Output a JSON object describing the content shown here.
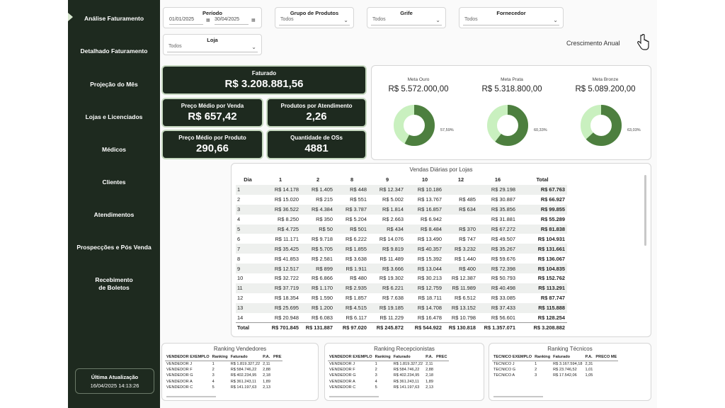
{
  "sidebar": {
    "items": [
      {
        "label": "Análise Faturamento",
        "active": true
      },
      {
        "label": "Detalhado Faturamento"
      },
      {
        "label": "Projeção do Mês"
      },
      {
        "label": "Lojas e Licenciados"
      },
      {
        "label": "Médicos"
      },
      {
        "label": "Clientes"
      },
      {
        "label": "Atendimentos"
      },
      {
        "label": "Prospecções e Pós Venda"
      },
      {
        "label": "Recebimento\nde Boletos"
      }
    ],
    "last_update_label": "Última Atualização",
    "last_update_value": "16/04/2025 14:13:26"
  },
  "filters": {
    "period": {
      "label": "Período",
      "start": "01/01/2025",
      "end": "30/04/2025"
    },
    "product_group": {
      "label": "Grupo de Produtos",
      "value": "Todos"
    },
    "brand": {
      "label": "Grife",
      "value": "Todos"
    },
    "supplier": {
      "label": "Fornecedor",
      "value": "Todos"
    },
    "store": {
      "label": "Loja",
      "value": "Todos"
    }
  },
  "growth_link": "Crescimento Anual",
  "kpis": {
    "revenue": {
      "label": "Faturado",
      "value": "R$ 3.208.881,56"
    },
    "avg_price_sale": {
      "label": "Preço Médio por Venda",
      "value": "R$ 657,42"
    },
    "products_per_service": {
      "label": "Produtos por Atendimento",
      "value": "2,26"
    },
    "avg_price_product": {
      "label": "Preço Médio por Produto",
      "value": "290,66"
    },
    "os_count": {
      "label": "Quantidade de OSs",
      "value": "4881"
    }
  },
  "goals": [
    {
      "label": "Meta Ouro",
      "value": "R$ 5.572.000,00",
      "pct_label": "57,59%",
      "pct": 57.59
    },
    {
      "label": "Meta Prata",
      "value": "R$ 5.318.800,00",
      "pct_label": "60,33%",
      "pct": 60.33
    },
    {
      "label": "Meta Bronze",
      "value": "R$ 5.089.200,00",
      "pct_label": "63,03%",
      "pct": 63.03
    }
  ],
  "colors": {
    "dark_green": "#1e2a1f",
    "donut_fill": "#4d7f3f",
    "donut_rest": "#c9f0bf"
  },
  "daily": {
    "title": "Vendas Diárias por Lojas",
    "headers": [
      "Dia",
      "1",
      "2",
      "8",
      "9",
      "10",
      "12",
      "16",
      "Total"
    ],
    "rows": [
      [
        "1",
        "R$ 14.178",
        "R$ 1.405",
        "R$ 448",
        "R$ 12.347",
        "R$ 10.186",
        "",
        "R$ 29.198",
        "R$ 67.763"
      ],
      [
        "2",
        "R$ 15.020",
        "R$ 215",
        "R$ 551",
        "R$ 5.002",
        "R$ 13.767",
        "R$ 485",
        "R$ 30.887",
        "R$ 66.927"
      ],
      [
        "3",
        "R$ 36.522",
        "R$ 4.384",
        "R$ 3.787",
        "R$ 1.814",
        "R$ 16.857",
        "R$ 634",
        "R$ 35.856",
        "R$ 99.855"
      ],
      [
        "4",
        "R$ 8.250",
        "R$ 350",
        "R$ 5.204",
        "R$ 2.663",
        "R$ 6.942",
        "",
        "R$ 31.881",
        "R$ 55.289"
      ],
      [
        "5",
        "R$ 4.725",
        "R$ 50",
        "R$ 501",
        "R$ 434",
        "R$ 8.484",
        "R$ 370",
        "R$ 67.272",
        "R$ 81.838"
      ],
      [
        "6",
        "R$ 11.171",
        "R$ 9.718",
        "R$ 6.222",
        "R$ 14.076",
        "R$ 13.490",
        "R$ 747",
        "R$ 49.507",
        "R$ 104.931"
      ],
      [
        "7",
        "R$ 35.425",
        "R$ 5.705",
        "R$ 1.855",
        "R$ 9.819",
        "R$ 40.357",
        "R$ 3.232",
        "R$ 35.267",
        "R$ 131.661"
      ],
      [
        "8",
        "R$ 41.853",
        "R$ 2.581",
        "R$ 3.638",
        "R$ 11.489",
        "R$ 15.392",
        "R$ 1.440",
        "R$ 59.676",
        "R$ 136.067"
      ],
      [
        "9",
        "R$ 12.517",
        "R$ 899",
        "R$ 1.911",
        "R$ 3.666",
        "R$ 13.044",
        "R$ 400",
        "R$ 72.398",
        "R$ 104.835"
      ],
      [
        "10",
        "R$ 32.722",
        "R$ 6.866",
        "R$ 480",
        "R$ 19.302",
        "R$ 30.213",
        "R$ 12.387",
        "R$ 50.793",
        "R$ 152.762"
      ],
      [
        "11",
        "R$ 37.719",
        "R$ 1.170",
        "R$ 2.935",
        "R$ 6.221",
        "R$ 12.759",
        "R$ 11.989",
        "R$ 40.498",
        "R$ 113.291"
      ],
      [
        "12",
        "R$ 18.354",
        "R$ 1.590",
        "R$ 1.857",
        "R$ 7.638",
        "R$ 18.711",
        "R$ 6.512",
        "R$ 33.085",
        "R$ 87.747"
      ],
      [
        "13",
        "R$ 25.695",
        "R$ 1.200",
        "R$ 4.515",
        "R$ 19.185",
        "R$ 14.708",
        "R$ 13.152",
        "R$ 37.433",
        "R$ 115.888"
      ],
      [
        "14",
        "R$ 20.948",
        "R$ 6.083",
        "R$ 6.117",
        "R$ 11.229",
        "R$ 16.478",
        "R$ 10.798",
        "R$ 56.601",
        "R$ 128.254"
      ]
    ],
    "total_row": [
      "Total",
      "R$ 701.845",
      "R$ 131.887",
      "R$ 97.020",
      "R$ 245.872",
      "R$ 544.922",
      "R$ 130.818",
      "R$ 1.357.071",
      "R$ 3.208.882"
    ]
  },
  "rankings": [
    {
      "title": "Ranking Vendedores",
      "headers": [
        "VENDEDOR EXEMPLO",
        "Ranking",
        "Faturado",
        "P.A.",
        "PRE"
      ],
      "rows": [
        [
          "VENDEDOR J",
          "1",
          "R$ 1.819.327,22",
          "2,11",
          ""
        ],
        [
          "VENDEDOR F",
          "2",
          "R$ 584.746,22",
          "2,88",
          ""
        ],
        [
          "VENDEDOR G",
          "3",
          "R$ 402.234,95",
          "2,18",
          ""
        ],
        [
          "VENDEDOR A",
          "4",
          "R$ 361.243,11",
          "1,89",
          ""
        ],
        [
          "VENDEDOR C",
          "5",
          "R$ 141.197,63",
          "2,13",
          ""
        ]
      ]
    },
    {
      "title": "Ranking Recepcionistas",
      "headers": [
        "VENDEDOR EXEMPLO",
        "Ranking",
        "Faturado",
        "P.A.",
        "PREC"
      ],
      "rows": [
        [
          "VENDEDOR J",
          "1",
          "R$ 1.819.327,22",
          "2,11",
          ""
        ],
        [
          "VENDEDOR F",
          "2",
          "R$ 584.746,22",
          "2,88",
          ""
        ],
        [
          "VENDEDOR G",
          "3",
          "R$ 402.234,95",
          "2,18",
          ""
        ],
        [
          "VENDEDOR A",
          "4",
          "R$ 361.243,11",
          "1,89",
          ""
        ],
        [
          "VENDEDOR C",
          "5",
          "R$ 141.197,63",
          "2,13",
          ""
        ]
      ]
    },
    {
      "title": "Ranking Técnicos",
      "headers": [
        "TECNICO EXEMPLO",
        "Ranking",
        "Faturado",
        "P.A.",
        "PRECO ME"
      ],
      "rows": [
        [
          "TECNICO J",
          "1",
          "R$ 3.167.594,18",
          "2,31",
          ""
        ],
        [
          "TECNICO G",
          "2",
          "R$ 23.746,52",
          "1,01",
          ""
        ],
        [
          "TECNICO A",
          "3",
          "R$ 17.542,06",
          "1,05",
          ""
        ]
      ]
    }
  ]
}
